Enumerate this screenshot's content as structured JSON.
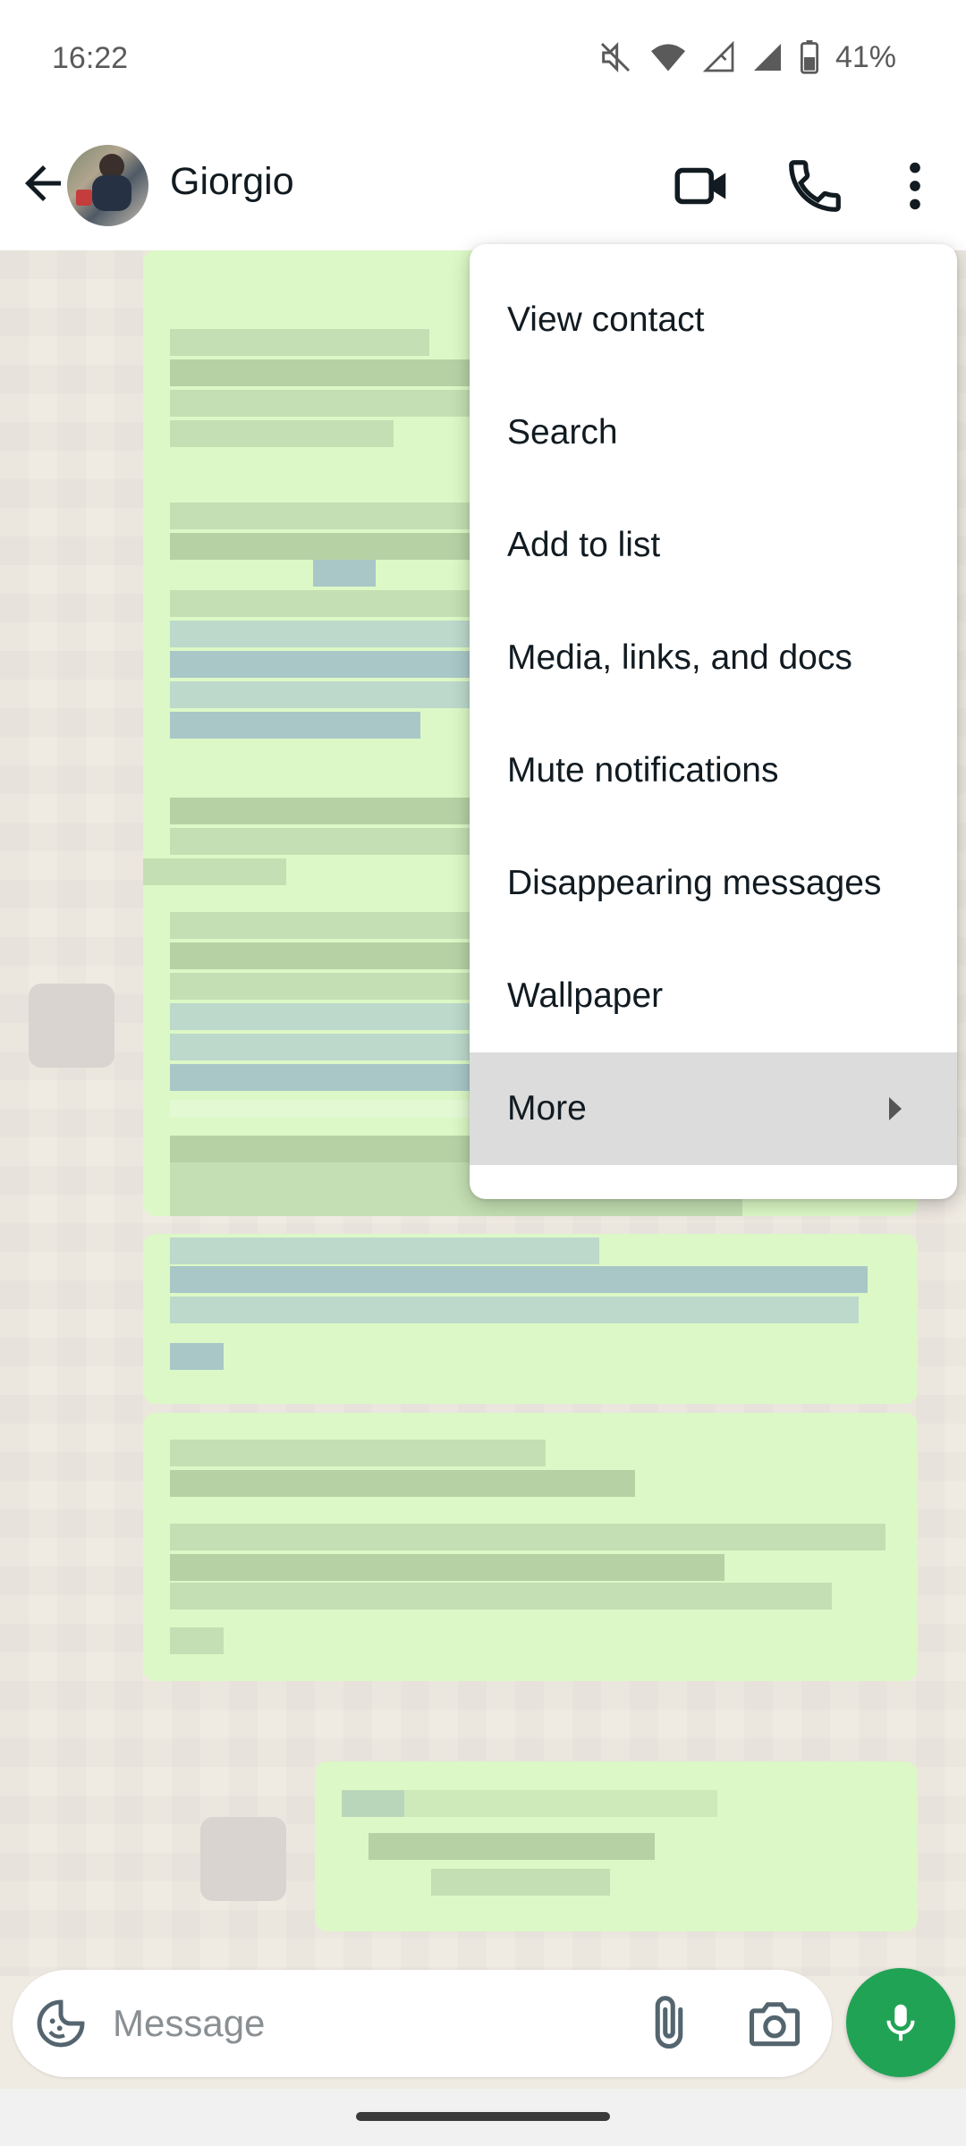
{
  "status_bar": {
    "time": "16:22",
    "battery": "41%",
    "icons": [
      "mute-icon",
      "wifi-icon",
      "signal-icon",
      "signal-icon",
      "battery-icon"
    ]
  },
  "header": {
    "contact_name": "Giorgio",
    "icons": [
      "back-arrow-icon",
      "video-call-icon",
      "phone-icon",
      "more-vert-icon"
    ]
  },
  "menu": {
    "items": [
      {
        "label": "View contact"
      },
      {
        "label": "Search"
      },
      {
        "label": "Add to list"
      },
      {
        "label": "Media, links, and docs"
      },
      {
        "label": "Mute notifications"
      },
      {
        "label": "Disappearing messages"
      },
      {
        "label": "Wallpaper"
      },
      {
        "label": "More",
        "has_submenu": true,
        "highlighted": true
      }
    ]
  },
  "composer": {
    "placeholder": "Message",
    "icons": [
      "emoji-sticker-icon",
      "attach-icon",
      "camera-icon",
      "mic-icon"
    ]
  },
  "colors": {
    "accent": "#21a355",
    "outgoing_bubble": "#dcf8c6",
    "chat_background": "#efeae2",
    "menu_highlight": "#dcdcdc"
  }
}
